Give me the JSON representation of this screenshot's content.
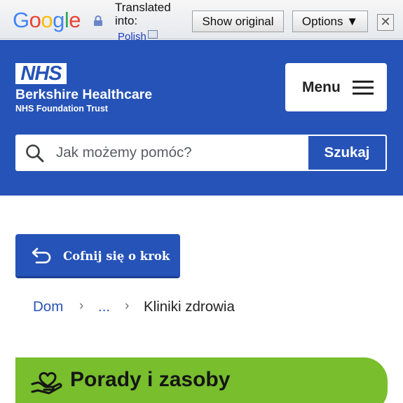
{
  "translate_bar": {
    "logo_letters": [
      "G",
      "o",
      "o",
      "g",
      "l",
      "e"
    ],
    "logo_colors": [
      "#4285f4",
      "#ea4335",
      "#fbbc05",
      "#4285f4",
      "#34a853",
      "#ea4335"
    ],
    "translated_into": "Translated into:",
    "language": "Polish",
    "show_original": "Show original",
    "options": "Options ▼",
    "close": "✕"
  },
  "header": {
    "logo_text": "NHS",
    "org_name": "Berkshire Healthcare",
    "org_subtitle": "NHS Foundation Trust",
    "menu_label": "Menu",
    "brand_color": "#2653b8"
  },
  "search": {
    "placeholder": "Jak możemy pomóc?",
    "button_label": "Szukaj"
  },
  "back_button": {
    "label": "Cofnij się o krok"
  },
  "breadcrumb": {
    "home": "Dom",
    "separator": "›",
    "ellipsis": "...",
    "current": "Kliniki zdrowia"
  },
  "advice_banner": {
    "label": "Porady i zasoby",
    "color": "#78be2d"
  }
}
